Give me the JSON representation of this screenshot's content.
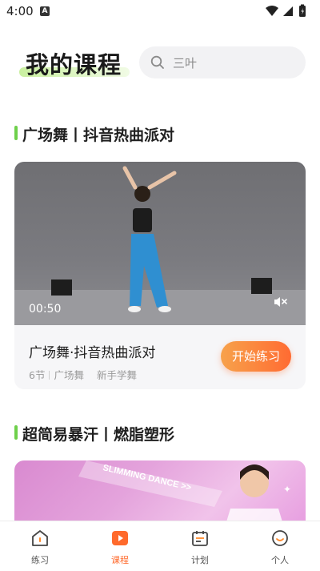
{
  "status_bar": {
    "time": "4:00",
    "notification": "A"
  },
  "header": {
    "title": "我的课程",
    "search_placeholder": "三叶"
  },
  "sections": [
    {
      "title": "广场舞丨抖音热曲派对",
      "course": {
        "video_duration": "00:50",
        "title": "广场舞·抖音热曲派对",
        "lessons": "6节",
        "category": "广场舞",
        "level": "新手学舞",
        "button_label": "开始练习"
      }
    },
    {
      "title": "超简易暴汗丨燃脂塑形",
      "banner_text": "SLIMMING DANCE >>"
    }
  ],
  "tabbar": {
    "items": [
      {
        "label": "练习",
        "icon": "practice-icon",
        "active": false
      },
      {
        "label": "课程",
        "icon": "course-play-icon",
        "active": true
      },
      {
        "label": "计划",
        "icon": "plan-calendar-icon",
        "active": false
      },
      {
        "label": "个人",
        "icon": "profile-face-icon",
        "active": false
      }
    ]
  },
  "colors": {
    "accent": "#ff6a2c",
    "section_bar": "#6ed04a",
    "button_start": "#f7a24b",
    "button_end": "#ff6b32"
  }
}
